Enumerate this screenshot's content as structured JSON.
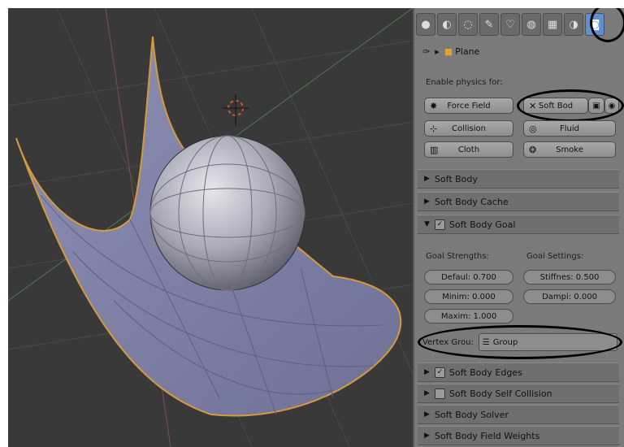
{
  "viewport": {
    "name": "3d-viewport"
  },
  "context": {
    "object_name": "Plane"
  },
  "physics": {
    "enable_label": "Enable physics for:",
    "buttons": {
      "force_field": "Force Field",
      "soft_body": "Soft Bod",
      "collision": "Collision",
      "fluid": "Fluid",
      "cloth": "Cloth",
      "smoke": "Smoke"
    }
  },
  "sections": {
    "soft_body": "Soft Body",
    "soft_body_cache": "Soft Body Cache",
    "soft_body_goal": "Soft Body Goal",
    "soft_body_edges": "Soft Body Edges",
    "soft_body_self_collision": "Soft Body Self Collision",
    "soft_body_solver": "Soft Body Solver",
    "soft_body_field_weights": "Soft Body Field Weights"
  },
  "goal": {
    "strengths_label": "Goal Strengths:",
    "settings_label": "Goal Settings:",
    "default": "Defaul: 0.700",
    "minimum": "Minim: 0.000",
    "maximum": "Maxim: 1.000",
    "stiffness": "Stiffnes: 0.500",
    "damping": "Dampi: 0.000",
    "vertex_group_label": "Vertex Grou:",
    "vertex_group_value": "Group"
  },
  "colors": {
    "accent": "#5f8fd1",
    "panel": "#7a7a7a",
    "viewport": "#393939"
  }
}
